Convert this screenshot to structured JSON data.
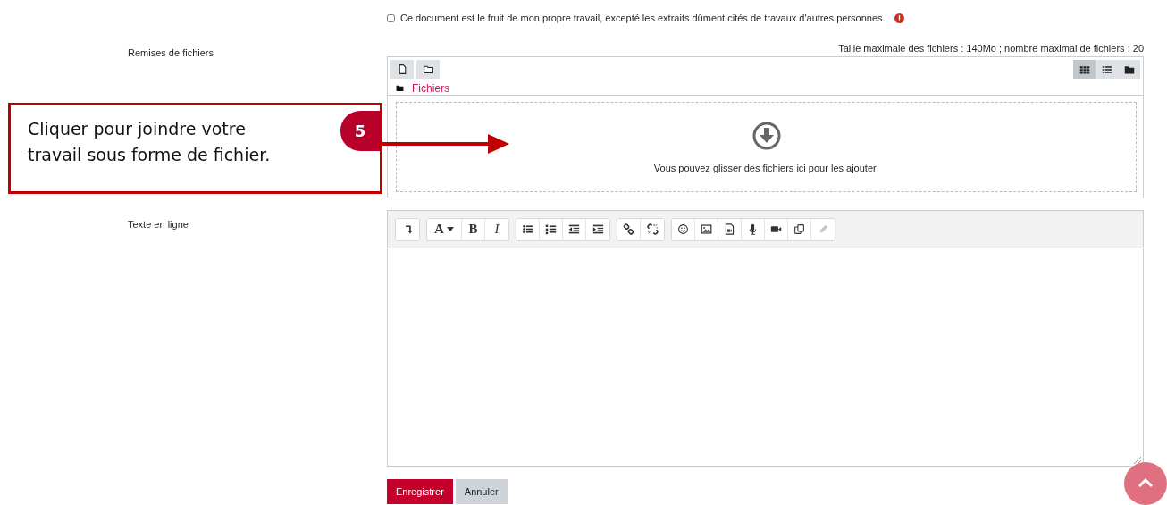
{
  "statement": {
    "label": "Ce document est le fruit de mon propre travail, excepté les extraits dûment cités de travaux d'autres personnes.",
    "checked": false,
    "required": true
  },
  "file_submissions": {
    "label": "Remises de fichiers",
    "limits": "Taille maximale des fichiers : 140Mo ; nombre maximal de fichiers : 20",
    "path": "Fichiers",
    "views": [
      {
        "kind": "icons",
        "selected": true
      },
      {
        "kind": "list",
        "selected": false
      },
      {
        "kind": "tree",
        "selected": false
      }
    ],
    "drop_hint": "Vous pouvez glisser des fichiers ici pour les ajouter."
  },
  "online_text": {
    "label": "Texte en ligne",
    "toolbar": [
      [
        {
          "kind": "collapse"
        }
      ],
      [
        {
          "kind": "font",
          "label": "A"
        },
        {
          "kind": "bold",
          "label": "B"
        },
        {
          "kind": "italic",
          "label": "I"
        }
      ],
      [
        {
          "kind": "bullets"
        },
        {
          "kind": "numbers"
        },
        {
          "kind": "outdent"
        },
        {
          "kind": "indent"
        }
      ],
      [
        {
          "kind": "link"
        },
        {
          "kind": "unlink"
        }
      ],
      [
        {
          "kind": "emoji"
        },
        {
          "kind": "image"
        },
        {
          "kind": "media"
        },
        {
          "kind": "audio"
        },
        {
          "kind": "video"
        },
        {
          "kind": "copy"
        },
        {
          "kind": "pencil",
          "disabled": true
        }
      ]
    ]
  },
  "buttons": [
    {
      "label": "Enregistrer",
      "kind": "primary"
    },
    {
      "label": "Annuler",
      "kind": "secondary"
    }
  ],
  "callout": {
    "number": "5",
    "text": "Cliquer pour joindre votre travail sous forme de fichier."
  }
}
